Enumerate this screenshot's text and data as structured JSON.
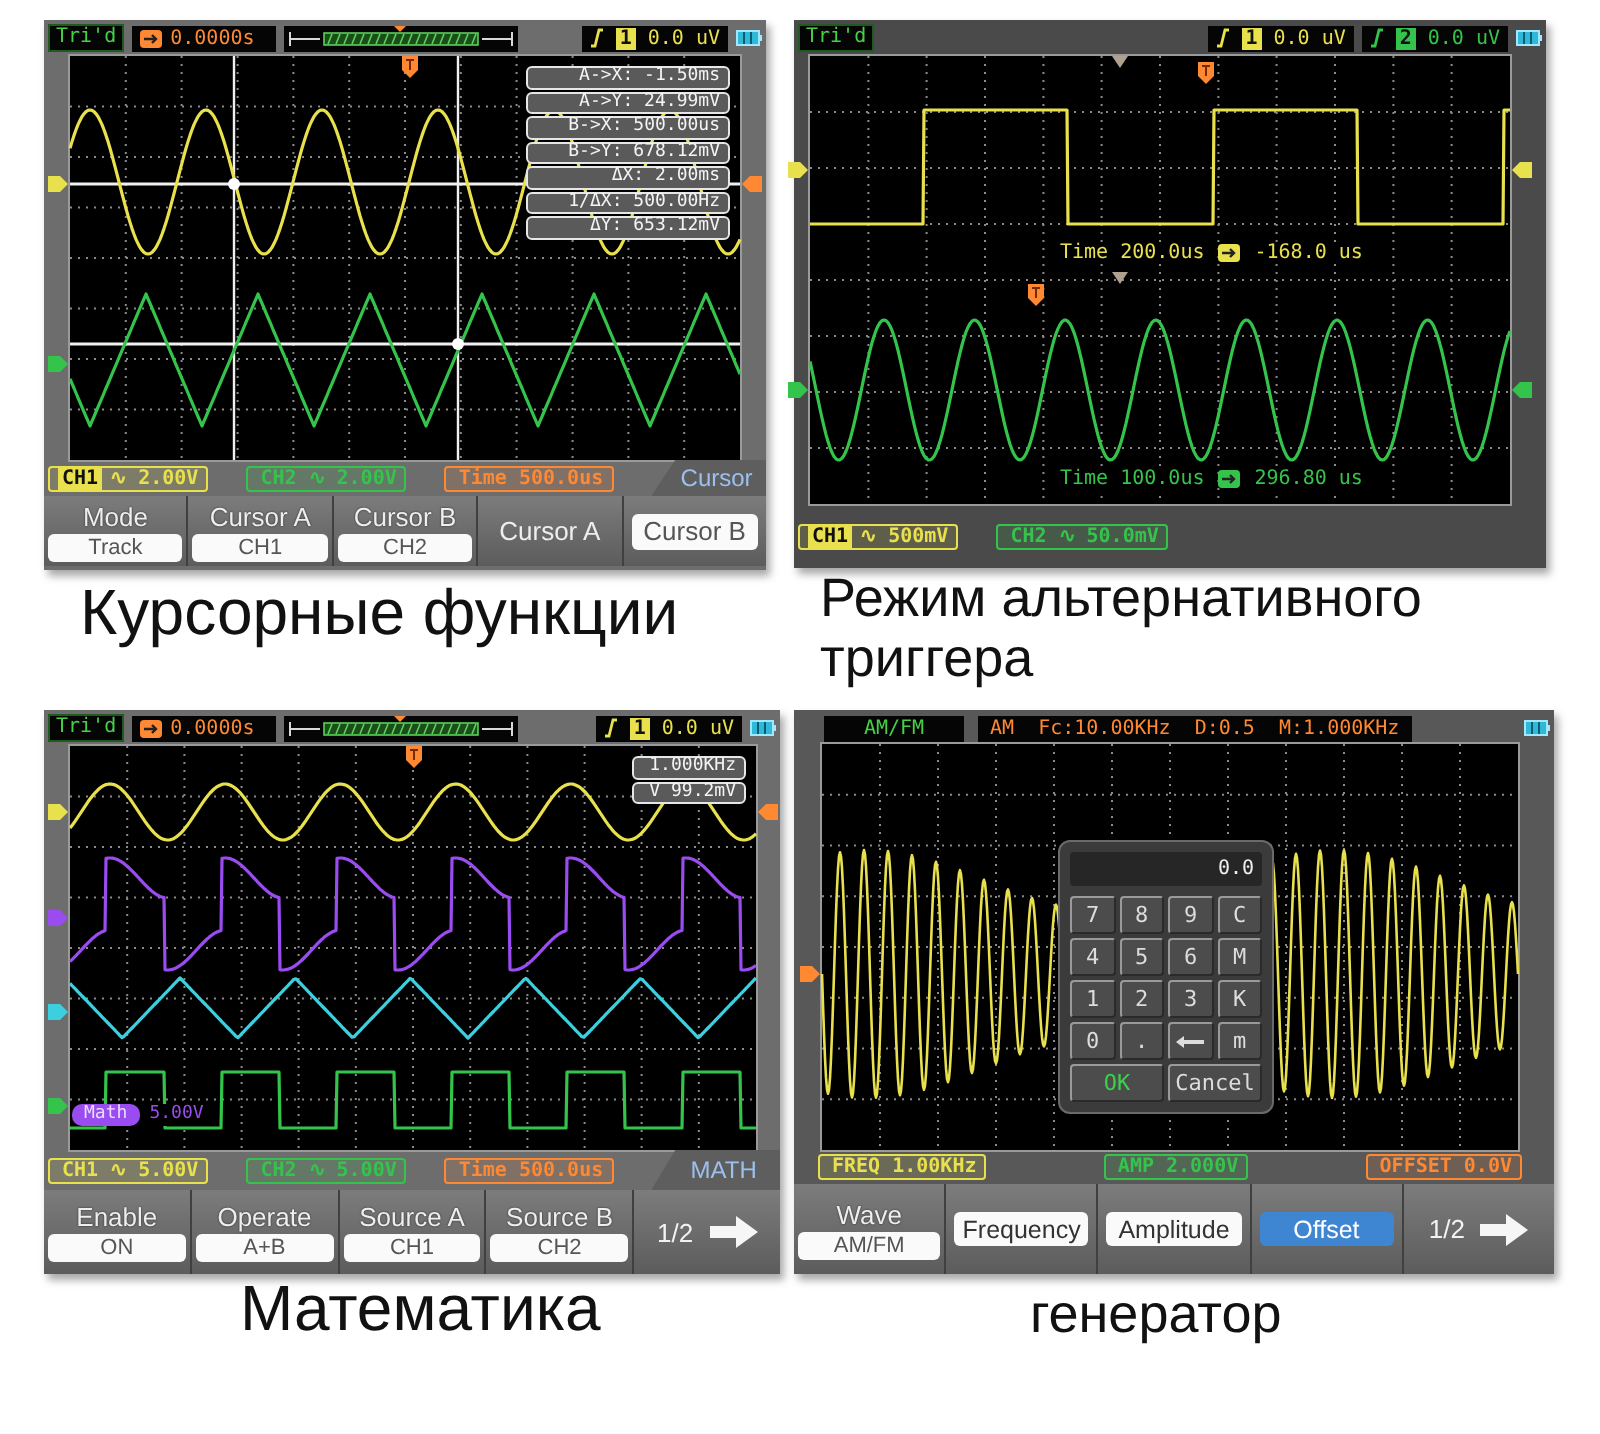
{
  "panels": [
    {
      "kind": "cursor",
      "status_bar": {
        "trigger_state": "Tri'd",
        "trigger_position": "0.0000s",
        "triggers": [
          {
            "channel": "1",
            "color": "#e8e04c",
            "value": "0.0",
            "unit": "uV"
          }
        ]
      },
      "readouts": [
        "A->X: -1.50ms",
        "A->Y: 24.99mV",
        "B->X: 500.00us",
        "B->Y: 678.12mV",
        "ΔX: 2.00ms",
        "1/ΔX: 500.00Hz",
        "ΔY: 653.12mV"
      ],
      "channel_bar": [
        {
          "label": "CH1",
          "value": "∿ 2.00V",
          "color": "#e8e04c",
          "selected": true
        },
        {
          "label": "CH2",
          "value": "∿ 2.00V",
          "color": "#34c44c",
          "selected": false
        },
        {
          "label": "Time",
          "value": "500.0us",
          "color": "#ff8833",
          "selected": false
        }
      ],
      "menu_title": "Cursor",
      "menu": [
        {
          "kind": "labeled",
          "label": "Mode",
          "value": "Track"
        },
        {
          "kind": "labeled",
          "label": "Cursor A",
          "value": "CH1"
        },
        {
          "kind": "labeled",
          "label": "Cursor B",
          "value": "CH2"
        },
        {
          "kind": "toggle",
          "label": "Cursor A",
          "selected": false
        },
        {
          "kind": "toggle",
          "label": "Cursor B",
          "selected": true
        }
      ],
      "caption": "Курсорные функции"
    },
    {
      "kind": "alternate_trigger",
      "status_bar": {
        "trigger_state": "Tri'd",
        "triggers": [
          {
            "channel": "1",
            "color": "#e8e04c",
            "value": "0.0",
            "unit": "uV"
          },
          {
            "channel": "2",
            "color": "#34c44c",
            "value": "0.0",
            "unit": "uV"
          }
        ]
      },
      "trace_labels": [
        {
          "timebase": "Time 200.0us",
          "delay": "-168.0 us",
          "color": "#e8e04c"
        },
        {
          "timebase": "Time 100.0us",
          "delay": "296.80 us",
          "color": "#34c44c"
        }
      ],
      "channel_bar": [
        {
          "label": "CH1",
          "value": "∿ 500mV",
          "color": "#e8e04c",
          "selected": true
        },
        {
          "label": "CH2",
          "value": "∿ 50.0mV",
          "color": "#34c44c",
          "selected": false
        }
      ],
      "caption": "Режим альтернативного триггера"
    },
    {
      "kind": "math",
      "status_bar": {
        "trigger_state": "Tri'd",
        "trigger_position": "0.0000s",
        "triggers": [
          {
            "channel": "1",
            "color": "#e8e04c",
            "value": "0.0",
            "unit": "uV"
          }
        ]
      },
      "readouts": [
        "1.000KHz",
        "V 99.2mV"
      ],
      "math_label": {
        "name": "Math",
        "scale": "5.00V"
      },
      "channel_bar": [
        {
          "label": "CH1",
          "value": "∿ 5.00V",
          "color": "#e8e04c",
          "selected": false
        },
        {
          "label": "CH2",
          "value": "∿ 5.00V",
          "color": "#34c44c",
          "selected": false
        },
        {
          "label": "Time",
          "value": "500.0us",
          "color": "#ff8833",
          "selected": false
        }
      ],
      "menu_title": "MATH",
      "menu": [
        {
          "kind": "labeled",
          "label": "Enable",
          "value": "ON"
        },
        {
          "kind": "labeled",
          "label": "Operate",
          "value": "A+B"
        },
        {
          "kind": "labeled",
          "label": "Source A",
          "value": "CH1"
        },
        {
          "kind": "labeled",
          "label": "Source B",
          "value": "CH2"
        },
        {
          "kind": "page",
          "label": "1/2"
        }
      ],
      "caption": "Математика"
    },
    {
      "kind": "generator",
      "status_bar": {
        "mode": "AM/FM",
        "parameters": "AM  Fc:10.00KHz  D:0.5  M:1.000KHz"
      },
      "keypad": {
        "display": "0.0",
        "keys": [
          {
            "kind": "char",
            "label": "7"
          },
          {
            "kind": "char",
            "label": "8"
          },
          {
            "kind": "char",
            "label": "9"
          },
          {
            "kind": "char",
            "label": "C"
          },
          {
            "kind": "char",
            "label": "4"
          },
          {
            "kind": "char",
            "label": "5"
          },
          {
            "kind": "char",
            "label": "6"
          },
          {
            "kind": "char",
            "label": "M"
          },
          {
            "kind": "char",
            "label": "1"
          },
          {
            "kind": "char",
            "label": "2"
          },
          {
            "kind": "char",
            "label": "3"
          },
          {
            "kind": "char",
            "label": "K"
          },
          {
            "kind": "char",
            "label": "0"
          },
          {
            "kind": "char",
            "label": "."
          },
          {
            "kind": "backspace"
          },
          {
            "kind": "char",
            "label": "m"
          }
        ],
        "confirm": "OK",
        "cancel": "Cancel"
      },
      "channel_bar": [
        {
          "label": "FREQ",
          "value": "1.00KHz",
          "color": "#e8e04c",
          "selected": false
        },
        {
          "label": "AMP",
          "value": "2.000V",
          "color": "#34c44c",
          "selected": false
        },
        {
          "label": "OFFSET",
          "value": "0.0V",
          "color": "#ff8833",
          "selected": false
        }
      ],
      "menu": [
        {
          "kind": "labeled",
          "label": "Wave",
          "value": "AM/FM"
        },
        {
          "kind": "field",
          "label": "Frequency",
          "selected": false
        },
        {
          "kind": "field",
          "label": "Amplitude",
          "selected": false
        },
        {
          "kind": "field",
          "label": "Offset",
          "selected": true
        },
        {
          "kind": "page",
          "label": "1/2"
        }
      ],
      "caption": "генератор"
    }
  ]
}
